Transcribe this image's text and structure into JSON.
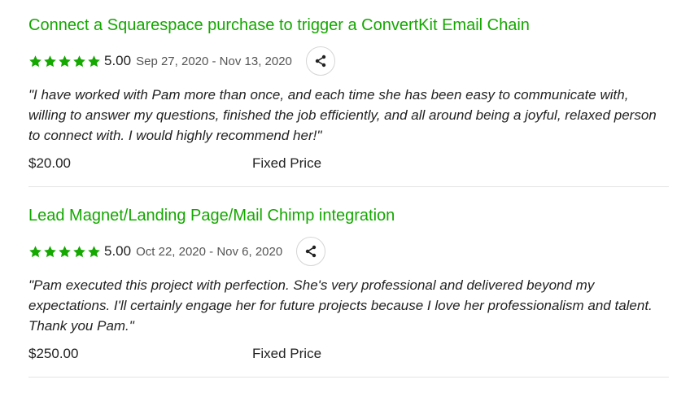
{
  "reviews": [
    {
      "title": "Connect a Squarespace purchase to trigger a ConvertKit Email Chain",
      "rating": "5.00",
      "stars": 5,
      "dates": "Sep 27, 2020 - Nov 13, 2020",
      "quote": "\"I have worked with Pam more than once, and each time she has been easy to communicate with, willing to answer my questions, finished the job efficiently, and all around being a joyful, relaxed person to connect with. I would highly recommend her!\"",
      "amount": "$20.00",
      "price_type": "Fixed Price",
      "icon": "share-icon"
    },
    {
      "title": "Lead Magnet/Landing Page/Mail Chimp integration",
      "rating": "5.00",
      "stars": 5,
      "dates": "Oct 22, 2020 - Nov 6, 2020",
      "quote": "\"Pam executed this project with perfection. She's very professional and delivered beyond my expectations. I'll certainly engage her for future projects because I love her professionalism and talent. Thank you Pam.\"",
      "amount": "$250.00",
      "price_type": "Fixed Price",
      "icon": "share-icon"
    }
  ],
  "colors": {
    "accent": "#14a800",
    "text": "#222222",
    "divider": "#e4e4e4"
  }
}
